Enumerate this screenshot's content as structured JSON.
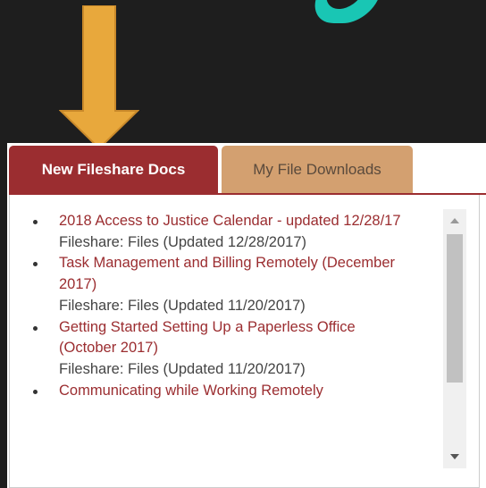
{
  "tabs": [
    {
      "label": "New Fileshare Docs",
      "active": true
    },
    {
      "label": "My File Downloads",
      "active": false
    }
  ],
  "files": [
    {
      "title": "2018 Access to Justice Calendar - updated 12/28/17",
      "meta": "Fileshare: Files (Updated 12/28/2017)"
    },
    {
      "title": "Task Management and Billing Remotely (December 2017)",
      "meta": "Fileshare: Files (Updated 11/20/2017)"
    },
    {
      "title": "Getting Started Setting Up a Paperless Office (October 2017)",
      "meta": "Fileshare: Files (Updated 11/20/2017)"
    },
    {
      "title": "Communicating while Working Remotely",
      "meta": ""
    }
  ],
  "icons": {
    "arrow": "down-arrow-icon",
    "scroll_up": "scroll-up-icon",
    "scroll_down": "scroll-down-icon"
  },
  "colors": {
    "active_tab": "#9b2d30",
    "inactive_tab": "#d3a070",
    "arrow": "#e8a83c",
    "background": "#1e1e1e",
    "teal": "#19c6b4"
  }
}
